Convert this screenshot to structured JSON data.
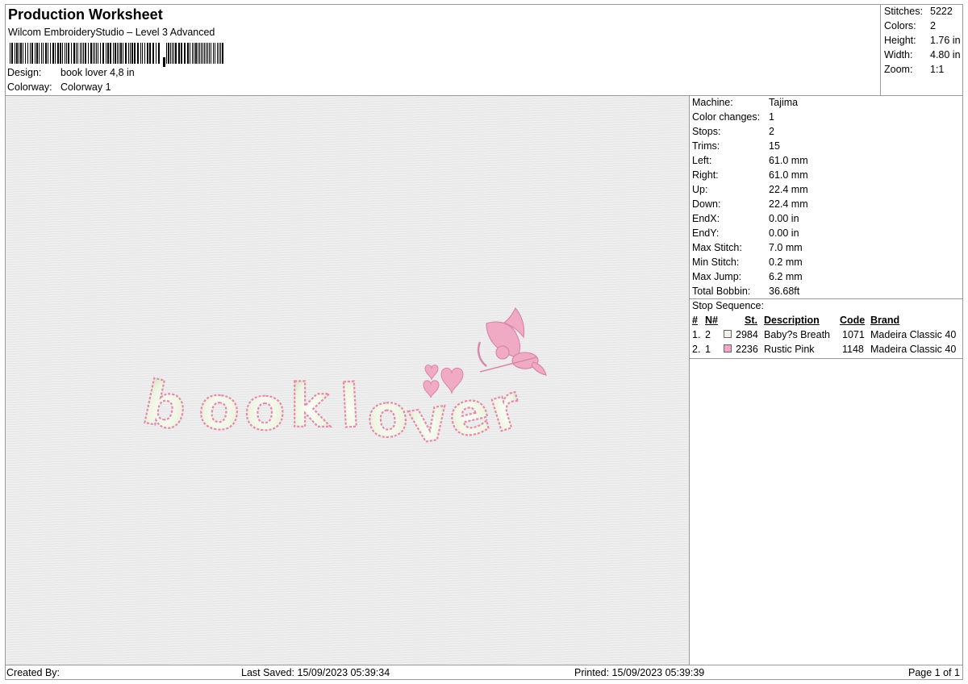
{
  "header": {
    "title": "Production Worksheet",
    "subtitle": "Wilcom EmbroideryStudio – Level 3 Advanced",
    "design_label": "Design:",
    "design_value": "book lover 4,8 in",
    "colorway_label": "Colorway:",
    "colorway_value": "Colorway 1"
  },
  "stats": [
    {
      "label": "Stitches:",
      "value": "5222"
    },
    {
      "label": "Colors:",
      "value": "2"
    },
    {
      "label": "Height:",
      "value": "1.76 in"
    },
    {
      "label": "Width:",
      "value": "4.80 in"
    },
    {
      "label": "Zoom:",
      "value": "1:1"
    }
  ],
  "machine_info": [
    {
      "label": "Machine:",
      "value": "Tajima"
    },
    {
      "label": "Color changes:",
      "value": "1"
    },
    {
      "label": "Stops:",
      "value": "2"
    },
    {
      "label": "Trims:",
      "value": "15"
    },
    {
      "label": "Left:",
      "value": "61.0 mm"
    },
    {
      "label": "Right:",
      "value": "61.0 mm"
    },
    {
      "label": "Up:",
      "value": "22.4 mm"
    },
    {
      "label": "Down:",
      "value": "22.4 mm"
    },
    {
      "label": "EndX:",
      "value": "0.00 in"
    },
    {
      "label": "EndY:",
      "value": "0.00 in"
    },
    {
      "label": "Max Stitch:",
      "value": "7.0 mm"
    },
    {
      "label": "Min Stitch:",
      "value": "0.2 mm"
    },
    {
      "label": "Max Jump:",
      "value": "6.2 mm"
    },
    {
      "label": "Total Bobbin:",
      "value": "36.68ft"
    }
  ],
  "stop_sequence": {
    "title": "Stop Sequence:",
    "headers": {
      "index": "#",
      "needle": "N#",
      "stitches": "St.",
      "description": "Description",
      "code": "Code",
      "brand": "Brand"
    },
    "rows": [
      {
        "index": "1.",
        "needle": "2",
        "swatch_color": "#eef3e6",
        "stitches": "2984",
        "description": "Baby?s Breath",
        "code": "1071",
        "brand": "Madeira Classic 40"
      },
      {
        "index": "2.",
        "needle": "1",
        "swatch_color": "#f2a7c6",
        "stitches": "2236",
        "description": "Rustic Pink",
        "code": "1148",
        "brand": "Madeira Classic 40"
      }
    ]
  },
  "design_preview": {
    "thread_colors": {
      "cream": "#eef3e0",
      "pink": "#f0aac4"
    }
  },
  "footer": {
    "created_by": "Created By:",
    "last_saved": "Last Saved: 15/09/2023 05:39:34",
    "printed": "Printed: 15/09/2023 05:39:39",
    "page": "Page 1 of 1"
  }
}
